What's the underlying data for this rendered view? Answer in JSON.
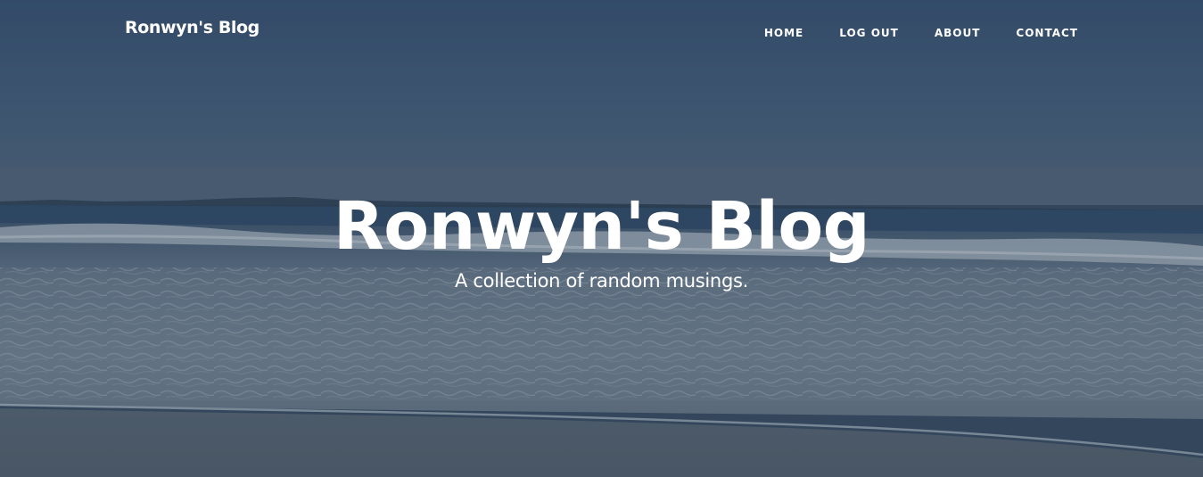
{
  "navbar": {
    "brand": "Ronwyn's Blog",
    "links": [
      {
        "label": "HOME"
      },
      {
        "label": "LOG OUT"
      },
      {
        "label": "ABOUT"
      },
      {
        "label": "CONTACT"
      }
    ]
  },
  "header": {
    "title": "Ronwyn's Blog",
    "subtitle": "A collection of random musings."
  },
  "colors": {
    "sky": "#3d5a7a",
    "horizon_haze": "#5a6e84",
    "ocean": "#3d5670",
    "surf": "#8fa0b0",
    "sand": "#5b6a78",
    "text": "#ffffff"
  }
}
